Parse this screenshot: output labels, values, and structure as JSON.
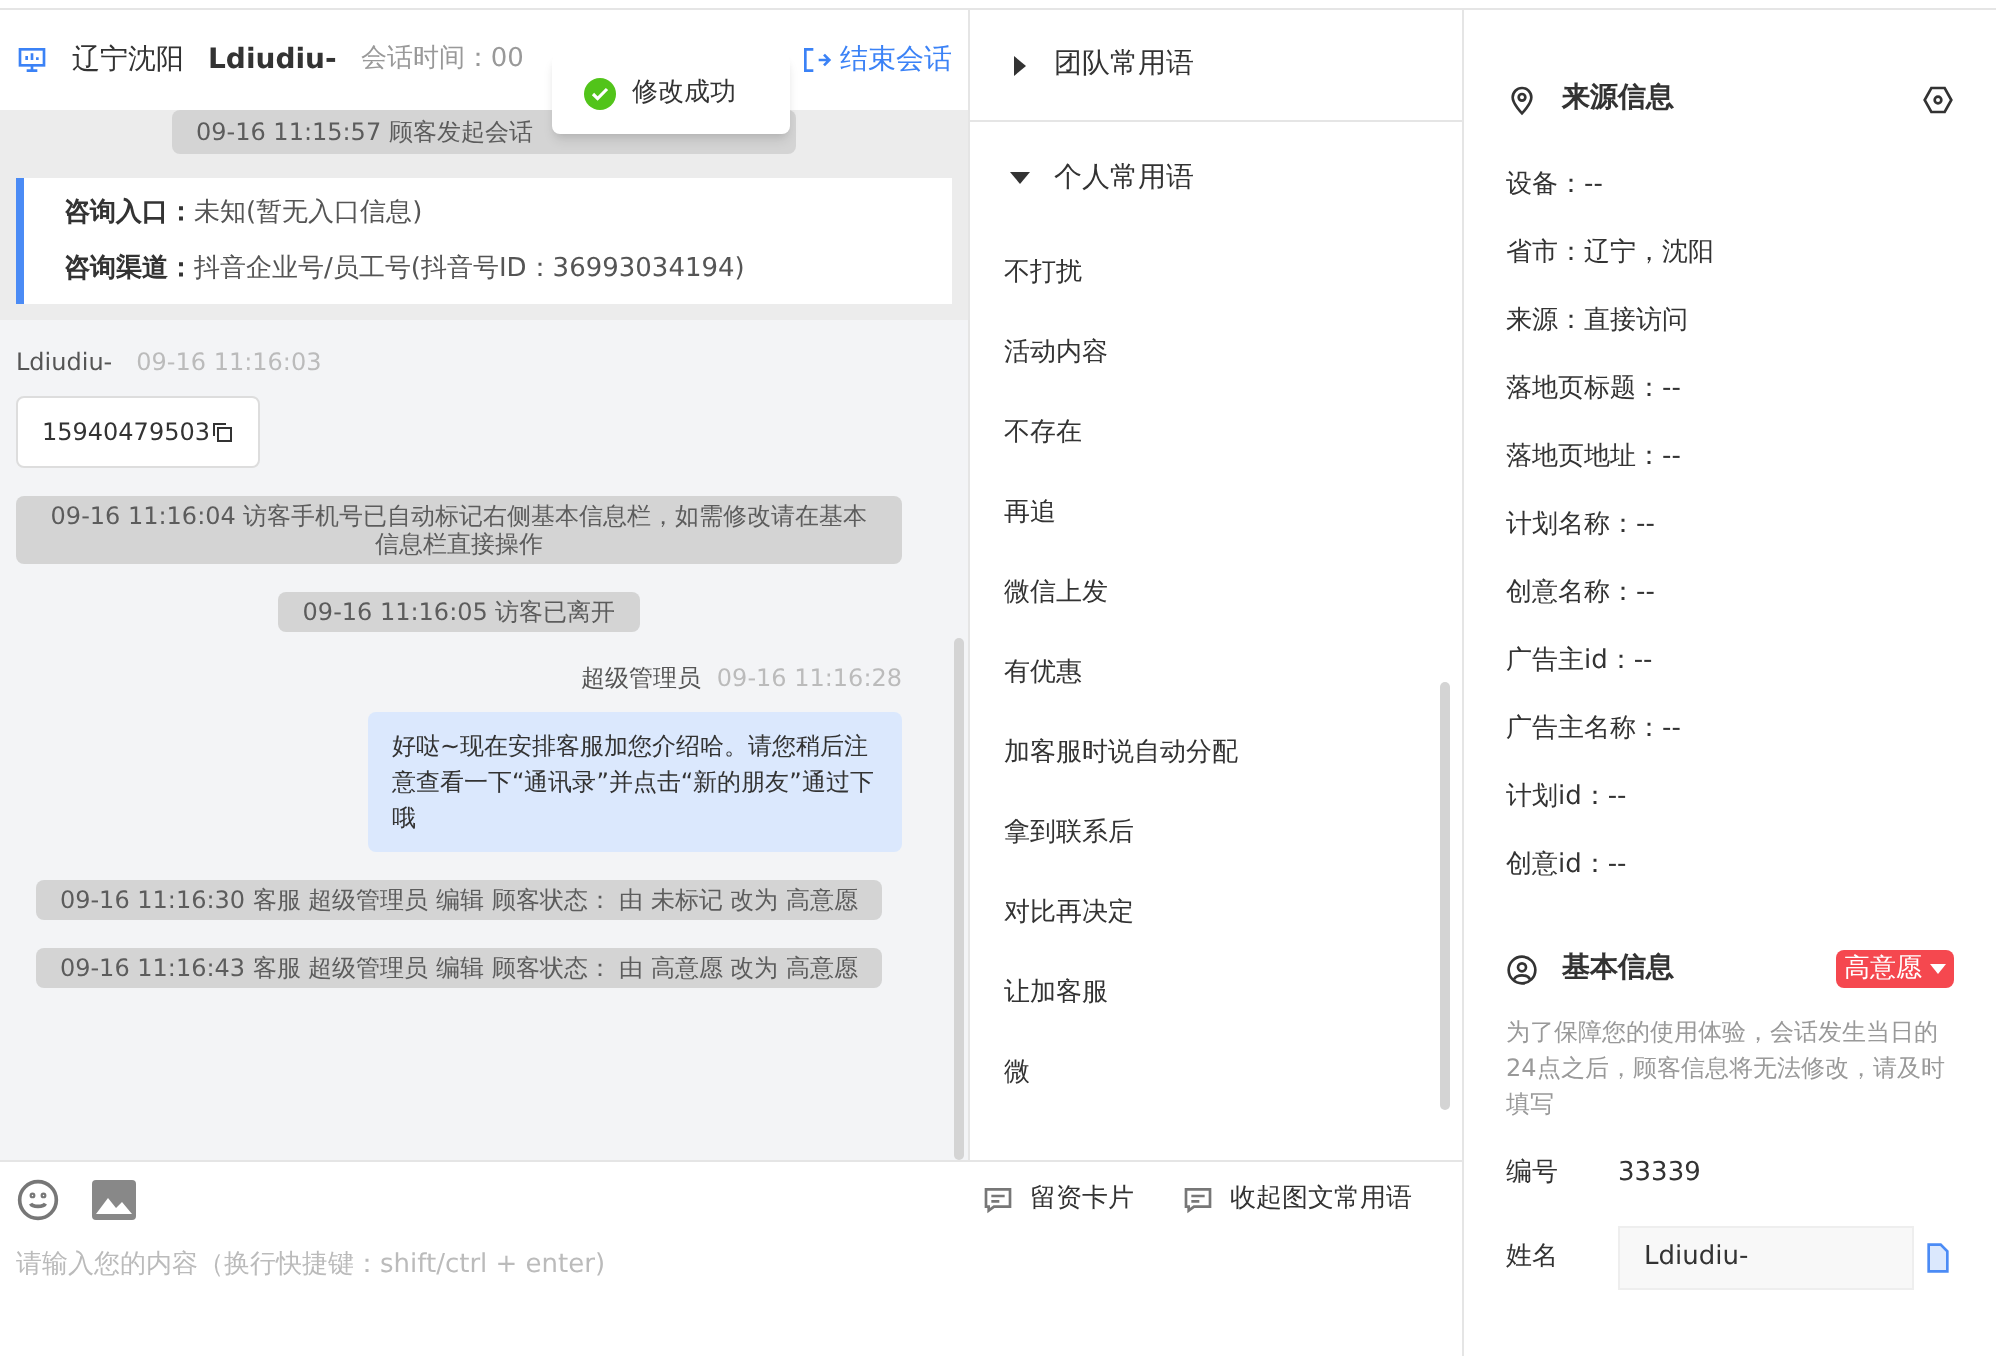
{
  "header": {
    "location": "辽宁沈阳",
    "visitor": "Ldiudiu-",
    "session_time": "会话时间：00",
    "end_button": "结束会话"
  },
  "toast": {
    "text": "修改成功"
  },
  "chat": {
    "top_notice": "09-16 11:15:57 顾客发起会话",
    "entry_card": [
      {
        "label": "咨询入口：",
        "value": "未知(暂无入口信息)"
      },
      {
        "label": "咨询渠道：",
        "value": "抖音企业号/员工号(抖音号ID：36993034194)"
      }
    ],
    "messages": [
      {
        "kind": "visitor",
        "sender": "Ldiudiu-",
        "time": "09-16 11:16:03",
        "text": "15940479503"
      },
      {
        "kind": "system",
        "text": "09-16 11:16:04 访客手机号已自动标记右侧基本信息栏，如需修改请在基本信息栏直接操作"
      },
      {
        "kind": "system",
        "text": "09-16 11:16:05 访客已离开"
      },
      {
        "kind": "agent",
        "sender": "超级管理员",
        "time": "09-16 11:16:28",
        "text": "好哒~现在安排客服加您介绍哈。请您稍后注意查看一下“通讯录”并点击“新的朋友”通过下哦"
      },
      {
        "kind": "system",
        "text": "09-16 11:16:30 客服 超级管理员 编辑 顾客状态： 由 未标记 改为 高意愿"
      },
      {
        "kind": "system",
        "text": "09-16 11:16:43 客服 超级管理员 编辑 顾客状态： 由 高意愿 改为 高意愿"
      }
    ]
  },
  "phrases": {
    "groups": [
      {
        "label": "团队常用语",
        "expanded": false
      },
      {
        "label": "个人常用语",
        "expanded": true
      }
    ],
    "items": [
      "不打扰",
      "活动内容",
      "不存在",
      "再追",
      "微信上发",
      "有优惠",
      "加客服时说自动分配",
      "拿到联系后",
      "对比再决定",
      "让加客服",
      "微"
    ]
  },
  "composer": {
    "actions": [
      "留资卡片",
      "收起图文常用语"
    ],
    "placeholder": "请输入您的内容（换行快捷键：shift/ctrl + enter)"
  },
  "source_info": {
    "title": "来源信息",
    "fields": [
      "设备：--",
      "省市：辽宁，沈阳",
      "来源：直接访问",
      "落地页标题：--",
      "落地页地址：--",
      "计划名称：--",
      "创意名称：--",
      "广告主id：--",
      "广告主名称：--",
      "计划id：--",
      "创意id：--"
    ]
  },
  "basic_info": {
    "title": "基本信息",
    "status_tag": "高意愿",
    "notice": "为了保障您的使用体验，会话发生当日的24点之后，顾客信息将无法修改，请及时填写",
    "fields": [
      {
        "kind": "text",
        "label": "编号",
        "value": "33339"
      },
      {
        "kind": "input",
        "label": "姓名",
        "value": "Ldiudiu-"
      }
    ]
  }
}
